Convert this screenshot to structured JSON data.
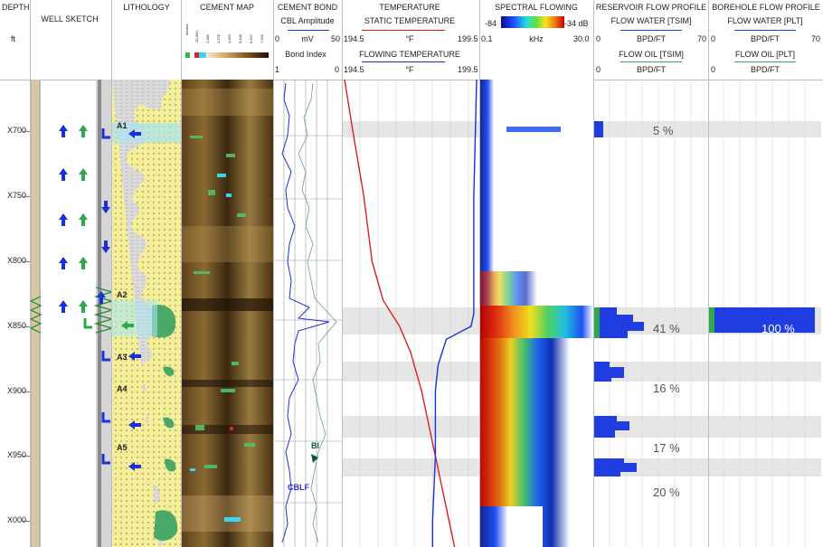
{
  "headers": {
    "depth": "DEPTH",
    "depth_unit": "ft",
    "well_sketch": "WELL SKETCH",
    "lithology": "LITHOLOGY",
    "cement_map": "CEMENT MAP",
    "cement_map_scale": [
      "Absent",
      "-30.000",
      "2.589",
      "3.578",
      "4.563",
      "5.548",
      "6.537",
      "7.509"
    ],
    "cement_map_values": [
      "1",
      "0"
    ],
    "cement_bond": "CEMENT BOND",
    "cbl_amplitude": "CBL Amplitude",
    "cbl_unit": "mV",
    "cbl_min": "0",
    "cbl_max": "50",
    "bond_index": "Bond Index",
    "bond_min": "1",
    "bond_max": "0",
    "temperature": "TEMPERATURE",
    "static_temp": "STATIC TEMPERATURE",
    "temp_unit": "°F",
    "static_min": "194.5",
    "static_max": "199.5",
    "flowing_temp": "FLOWING TEMPERATURE",
    "flowing_min": "194.5",
    "flowing_max": "199.5",
    "spectral_flowing": "SPECTRAL FLOWING",
    "db_min": "-84",
    "db_max": "-34 dB",
    "khz_min": "0.1",
    "khz_unit": "kHz",
    "khz_max": "30.0",
    "reservoir_flow": "RESERVOIR FLOW PROFILE",
    "flow_water_tsim": "FLOW WATER [TSIM]",
    "bpd_ft": "BPD/FT",
    "res_min": "0",
    "res_max": "70",
    "flow_oil_tsim": "FLOW OIL [TSIM]",
    "borehole_flow": "BOREHOLE FLOW PROFILE",
    "flow_water_plt": "FLOW WATER [PLT]",
    "flow_oil_plt": "FLOW OIL [PLT]",
    "bh_min": "0",
    "bh_max": "70"
  },
  "zone_labels": [
    "A1",
    "A2",
    "A3",
    "A4",
    "A5"
  ],
  "curve_labels": {
    "bi": "BI",
    "cblf": "CBLF"
  },
  "colors": {
    "static_temp": "#e11d1d",
    "flowing_temp": "#1a2fd6",
    "water_bar": "#1f3de0",
    "oil_bar": "#2fa84a",
    "lithology_sand": "#f5ef9a",
    "cement_brown": "#6b4a22",
    "shade": "#e2e2e2"
  },
  "chart_data": {
    "type": "well-log",
    "depth_axis": {
      "label": "DEPTH",
      "unit": "ft",
      "ticks": [
        "X700",
        "X750",
        "X800",
        "X850",
        "X900",
        "X950",
        "X000"
      ],
      "range": [
        660,
        1020
      ]
    },
    "static_temperature": {
      "unit": "°F",
      "range": [
        194.5,
        199.5
      ],
      "depth": [
        660,
        700,
        750,
        800,
        830,
        850,
        870,
        900,
        950,
        1000,
        1020
      ],
      "values": [
        194.6,
        194.9,
        195.3,
        195.6,
        196.0,
        196.6,
        197.0,
        197.4,
        197.9,
        198.4,
        198.6
      ]
    },
    "flowing_temperature": {
      "unit": "°F",
      "range": [
        194.5,
        199.5
      ],
      "depth": [
        660,
        750,
        840,
        850,
        860,
        880,
        900,
        950,
        1000,
        1020
      ],
      "values": [
        199.4,
        199.3,
        199.3,
        199.2,
        198.3,
        198.0,
        197.9,
        197.9,
        197.8,
        197.8
      ]
    },
    "reservoir_flow_profile": [
      {
        "zone": "A1",
        "percent": "5 %",
        "depth": 700
      },
      {
        "zone": "A2",
        "percent": "41 %",
        "depth": 852
      },
      {
        "zone": "A3",
        "percent": "16 %",
        "depth": 898
      },
      {
        "zone": "A4",
        "percent": "17 %",
        "depth": 944
      },
      {
        "zone": "A5",
        "percent": "20 %",
        "depth": 978
      }
    ],
    "borehole_flow_profile": [
      {
        "zone": "A2",
        "percent": "100 %",
        "depth": 852
      }
    ]
  }
}
